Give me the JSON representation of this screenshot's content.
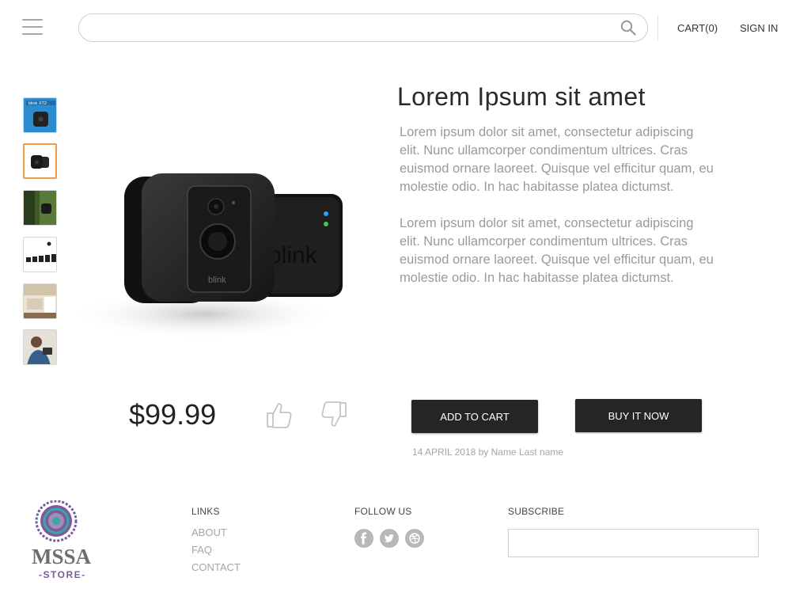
{
  "header": {
    "search_placeholder": "",
    "cart_label": "CART(0)",
    "signin_label": "SIGN IN"
  },
  "thumbnails": [
    {
      "label": "blink XT2"
    },
    {
      "label": ""
    },
    {
      "label": ""
    },
    {
      "label": ""
    },
    {
      "label": ""
    },
    {
      "label": ""
    }
  ],
  "product": {
    "image_brand": "blink",
    "title": "Lorem Ipsum sit amet",
    "description_1": "Lorem ipsum dolor sit amet, consectetur adipiscing elit. Nunc ullamcorper condimentum ultrices. Cras euismod ornare laoreet. Quisque vel efficitur quam, eu molestie odio. In hac habitasse platea dictumst.",
    "description_2": "Lorem ipsum dolor sit amet, consectetur adipiscing elit. Nunc ullamcorper condimentum ultrices. Cras euismod ornare laoreet. Quisque vel efficitur quam, eu molestie odio. In hac habitasse platea dictumst.",
    "price": "$99.99",
    "add_to_cart_label": "ADD TO CART",
    "buy_now_label": "BUY IT NOW",
    "meta": "14 APRIL 2018 by Name Last name"
  },
  "footer": {
    "logo_text": "MSSA",
    "logo_subtext": "-STORE-",
    "links_heading": "LINKS",
    "links": [
      "ABOUT",
      "FAQ",
      "CONTACT"
    ],
    "follow_heading": "FOLLOW US",
    "social_icons": [
      "facebook-icon",
      "twitter-icon",
      "dribbble-icon"
    ],
    "subscribe_heading": "SUBSCRIBE",
    "subscribe_placeholder": ""
  },
  "colors": {
    "accent_orange": "#f29a47",
    "button_dark": "#252525",
    "logo_purple": "#7a5b9c",
    "logo_teal": "#3aa6a5"
  }
}
